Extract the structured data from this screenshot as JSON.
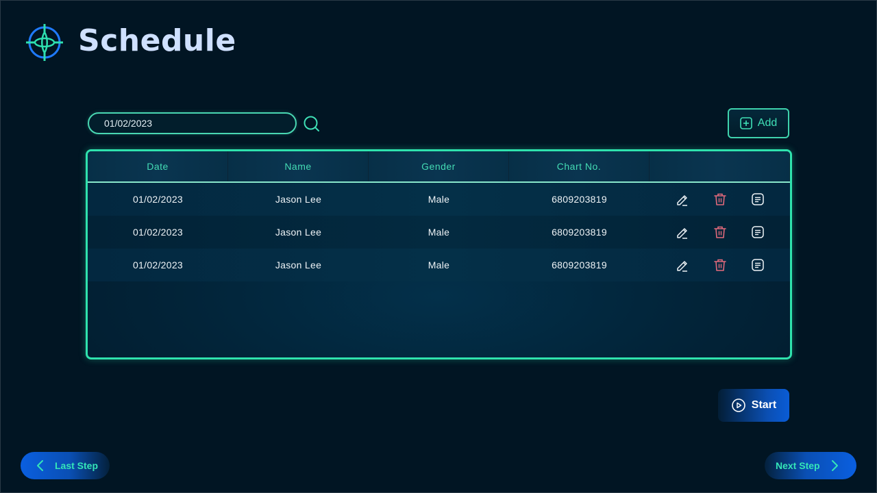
{
  "header": {
    "title": "Schedule",
    "logo_icon": "crosshair-compass-icon"
  },
  "search": {
    "value": "01/02/2023",
    "icon": "search-icon"
  },
  "toolbar": {
    "add_label": "Add",
    "add_icon": "plus-square-icon"
  },
  "table": {
    "columns": [
      "Date",
      "Name",
      "Gender",
      "Chart No.",
      ""
    ],
    "rows": [
      {
        "date": "01/02/2023",
        "name": "Jason Lee",
        "gender": "Male",
        "chart_no": "6809203819"
      },
      {
        "date": "01/02/2023",
        "name": "Jason Lee",
        "gender": "Male",
        "chart_no": "6809203819"
      },
      {
        "date": "01/02/2023",
        "name": "Jason Lee",
        "gender": "Male",
        "chart_no": "6809203819"
      }
    ],
    "row_actions": [
      "edit-icon",
      "delete-icon",
      "notes-icon"
    ]
  },
  "start": {
    "label": "Start",
    "icon": "play-circle-icon"
  },
  "nav": {
    "last_label": "Last Step",
    "next_label": "Next Step"
  },
  "colors": {
    "accent": "#3fe0b6",
    "title": "#cfe0ff",
    "danger": "#e36a7c",
    "background": "#011523",
    "button_blue": "#0a5fe0"
  }
}
